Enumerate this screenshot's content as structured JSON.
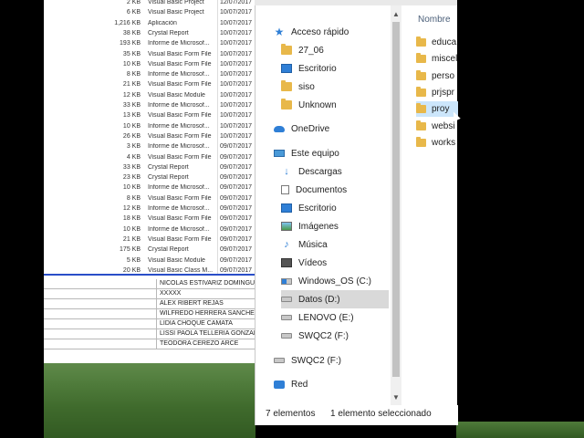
{
  "background_list": [
    {
      "size": "2 KB",
      "type": "Visual Basic Project",
      "date": "12/07/2017"
    },
    {
      "size": "6 KB",
      "type": "Visual Basic Project",
      "date": "10/07/2017"
    },
    {
      "size": "1,216 KB",
      "type": "Aplicación",
      "date": "10/07/2017"
    },
    {
      "size": "38 KB",
      "type": "Crystal Report",
      "date": "10/07/2017"
    },
    {
      "size": "193 KB",
      "type": "Informe de Microsof...",
      "date": "10/07/2017"
    },
    {
      "size": "35 KB",
      "type": "Visual Basic Form File",
      "date": "10/07/2017"
    },
    {
      "size": "10 KB",
      "type": "Visual Basic Form File",
      "date": "10/07/2017"
    },
    {
      "size": "8 KB",
      "type": "Informe de Microsof...",
      "date": "10/07/2017"
    },
    {
      "size": "21 KB",
      "type": "Visual Basic Form File",
      "date": "10/07/2017"
    },
    {
      "size": "12 KB",
      "type": "Visual Basic Module",
      "date": "10/07/2017"
    },
    {
      "size": "33 KB",
      "type": "Informe de Microsof...",
      "date": "10/07/2017"
    },
    {
      "size": "13 KB",
      "type": "Visual Basic Form File",
      "date": "10/07/2017"
    },
    {
      "size": "10 KB",
      "type": "Informe de Microsof...",
      "date": "10/07/2017"
    },
    {
      "size": "26 KB",
      "type": "Visual Basic Form File",
      "date": "10/07/2017"
    },
    {
      "size": "3 KB",
      "type": "Informe de Microsof...",
      "date": "09/07/2017"
    },
    {
      "size": "4 KB",
      "type": "Visual Basic Form File",
      "date": "09/07/2017"
    },
    {
      "size": "33 KB",
      "type": "Crystal Report",
      "date": "09/07/2017"
    },
    {
      "size": "23 KB",
      "type": "Crystal Report",
      "date": "09/07/2017"
    },
    {
      "size": "10 KB",
      "type": "Informe de Microsof...",
      "date": "09/07/2017"
    },
    {
      "size": "8 KB",
      "type": "Visual Basic Form File",
      "date": "09/07/2017"
    },
    {
      "size": "12 KB",
      "type": "Informe de Microsof...",
      "date": "09/07/2017"
    },
    {
      "size": "18 KB",
      "type": "Visual Basic Form File",
      "date": "09/07/2017"
    },
    {
      "size": "10 KB",
      "type": "Informe de Microsof...",
      "date": "09/07/2017"
    },
    {
      "size": "21 KB",
      "type": "Visual Basic Form File",
      "date": "09/07/2017"
    },
    {
      "size": "175 KB",
      "type": "Crystal Report",
      "date": "09/07/2017"
    },
    {
      "size": "5 KB",
      "type": "Visual Basic Module",
      "date": "09/07/2017"
    },
    {
      "size": "20 KB",
      "type": "Visual Basic Class M...",
      "date": "09/07/2017"
    }
  ],
  "sheet_rows": [
    "NICOLAS ESTIVARIZ DOMINGUEZ",
    "XXXXX",
    "ALEX RIBERT REJAS",
    "WILFREDO HERRERA SANCHEZ",
    "LIDIA CHOQUE CAMATA",
    "LISSI PAOLA TELLERIA GONZALES",
    "TEODORA CEREZO ARCE"
  ],
  "nav": {
    "quick_access": "Acceso rápido",
    "qa_items": [
      "27_06",
      "Escritorio",
      "siso",
      "Unknown"
    ],
    "onedrive": "OneDrive",
    "this_pc": "Este equipo",
    "pc_items": [
      "Descargas",
      "Documentos",
      "Escritorio",
      "Imágenes",
      "Música",
      "Vídeos"
    ],
    "drives": [
      "Windows_OS (C:)",
      "Datos (D:)",
      "LENOVO (E:)",
      "SWQC2 (F:)"
    ],
    "swqc2_root": "SWQC2 (F:)",
    "network": "Red"
  },
  "content": {
    "column_header": "Nombre",
    "items": [
      "educa",
      "miscel",
      "perso",
      "prjspr",
      "proy",
      "websi",
      "works"
    ],
    "selected_index": 4
  },
  "status": {
    "count": "7 elementos",
    "selection": "1 elemento seleccionado"
  },
  "colors": {
    "folder": "#e8b84a",
    "accent": "#2f7fd6",
    "selected_nav": "#d9d9d9",
    "selected_item": "#cce6fb"
  }
}
